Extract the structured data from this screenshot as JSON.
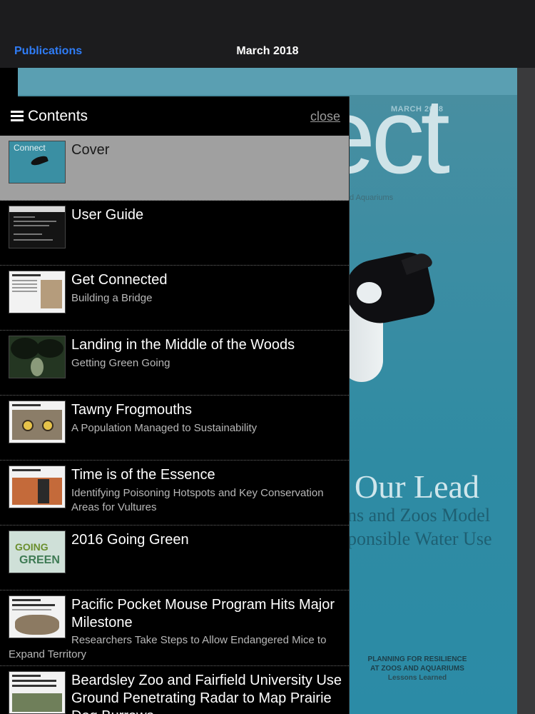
{
  "nav": {
    "back_label": "Publications",
    "title": "March 2018"
  },
  "cover": {
    "date": "MARCH 2018",
    "masthead": "ect",
    "masthead_sub": "d Aquariums",
    "headline_1": "Our Lead",
    "headline_2": "ns and Zoos Model",
    "headline_3": "ponsible Water Use",
    "feature_1": "PLANNING FOR RESILIENCE",
    "feature_2": "AT ZOOS AND AQUARIUMS",
    "feature_3": "Lessons Learned"
  },
  "panel": {
    "title": "Contents",
    "close_label": "close",
    "items": [
      {
        "title": "Cover",
        "subtitle": "",
        "thumb": "cover",
        "thumb_text": "Connect",
        "selected": true
      },
      {
        "title": "User Guide",
        "subtitle": "",
        "thumb": "guide"
      },
      {
        "title": "Get Connected",
        "subtitle": "Building a Bridge",
        "thumb": "doc"
      },
      {
        "title": "Landing in the Middle of the Woods",
        "subtitle": "Getting Green Going",
        "thumb": "woods"
      },
      {
        "title": "Tawny Frogmouths",
        "subtitle": "A Population Managed to Sustainability",
        "thumb": "owl"
      },
      {
        "title": "Time is of the Essence",
        "subtitle": "Identifying Poisoning Hotspots and Key Conservation Areas for Vultures",
        "thumb": "vulture"
      },
      {
        "title": "2016 Going Green",
        "subtitle": "",
        "thumb": "green",
        "thumb_text_1": "GOING",
        "thumb_text_2": "GREEN"
      },
      {
        "title": "Pacific Pocket Mouse Program Hits Major Milestone",
        "subtitle": "Researchers Take Steps to Allow Endangered Mice to Expand Territory",
        "thumb": "doc"
      },
      {
        "title": "Beardsley Zoo and Fairfield University Use Ground Penetrating Radar to Map Prairie Dog Burrows",
        "subtitle": "",
        "thumb": "doc"
      }
    ]
  },
  "colors": {
    "accent": "#2f7cf6",
    "selected_row": "#a0a0a0",
    "cover_teal": "#2f8ba3"
  }
}
